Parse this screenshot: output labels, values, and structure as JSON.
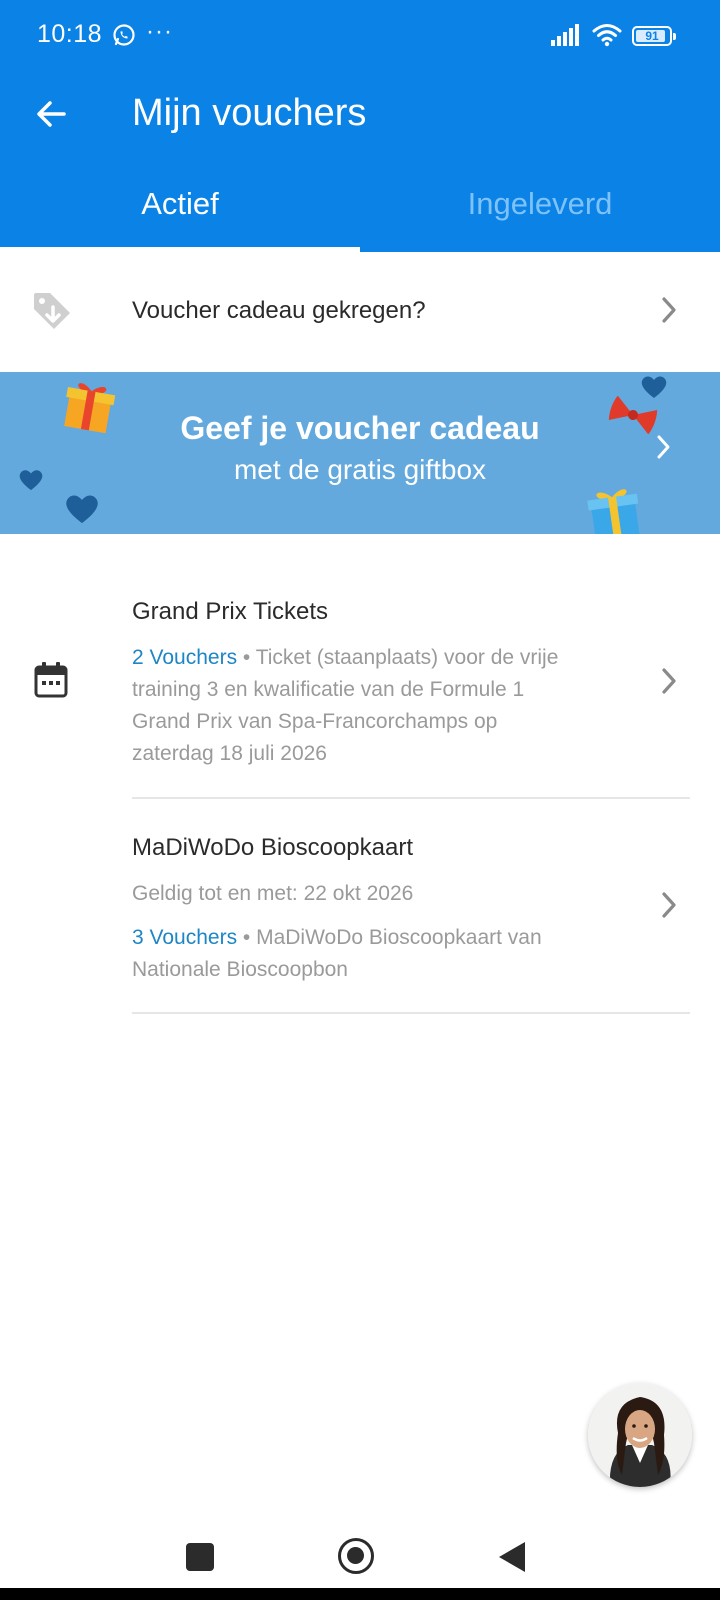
{
  "status_bar": {
    "time": "10:18",
    "extra": "···",
    "battery": "91",
    "battery_level": 0.91
  },
  "header": {
    "title": "Mijn vouchers",
    "tabs": [
      {
        "label": "Actief",
        "active": true
      },
      {
        "label": "Ingeleverd",
        "active": false
      }
    ]
  },
  "gift_row": {
    "label": "Voucher cadeau gekregen?"
  },
  "banner": {
    "line1": "Geef je voucher cadeau",
    "line2": "met de gratis giftbox"
  },
  "vouchers": [
    {
      "title": "Grand Prix Tickets",
      "count": "2 Vouchers",
      "description": " • Ticket (staanplaats) voor de vrije training 3 en kwalificatie van de Formule 1 Grand Prix van Spa-Francorchamps op zaterdag 18 juli 2026"
    },
    {
      "title": "MaDiWoDo Bioscoopkaart",
      "validity": "Geldig tot en met: 22 okt 2026",
      "count": "3 Vouchers",
      "description": " • MaDiWoDo Bioscoopkaart van Nationale Bioscoopbon"
    }
  ],
  "colors": {
    "primary": "#0a82e6",
    "banner": "#63a9de",
    "link": "#1d86c6",
    "muted": "#9a9a9a"
  },
  "icons": [
    "whatsapp-icon",
    "signal-icon",
    "wifi-icon",
    "battery-icon",
    "back-arrow-icon",
    "tag-download-icon",
    "chevron-right-icon",
    "calendar-icon",
    "gift-icon",
    "heart-icon",
    "bow-icon"
  ]
}
